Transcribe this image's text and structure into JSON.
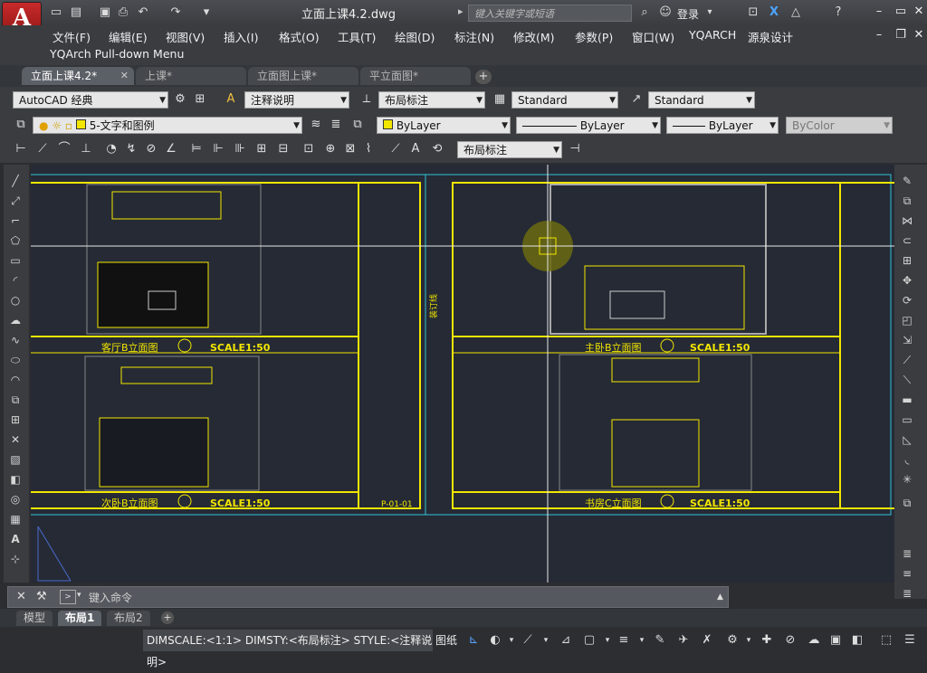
{
  "app": {
    "logo_letter": "A",
    "title": "立面上课4.2.dwg",
    "search_placeholder": "键入关键字或短语",
    "login": "登录"
  },
  "menu": [
    "文件(F)",
    "编辑(E)",
    "视图(V)",
    "插入(I)",
    "格式(O)",
    "工具(T)",
    "绘图(D)",
    "标注(N)",
    "修改(M)",
    "参数(P)",
    "窗口(W)",
    "YQARCH",
    "源泉设计"
  ],
  "pulldown_menu": "YQArch Pull-down Menu",
  "tabs": [
    {
      "label": "立面上课4.2*",
      "active": true
    },
    {
      "label": "上课*",
      "active": false
    },
    {
      "label": "立面图上课*",
      "active": false
    },
    {
      "label": "平立面图*",
      "active": false
    }
  ],
  "toolbar1": {
    "workspace": "AutoCAD 经典",
    "text_style": "注释说明",
    "dim_style": "布局标注",
    "table_style": "Standard",
    "multileader_style": "Standard"
  },
  "toolbar2": {
    "layer": "5-文字和图例",
    "color": "ByLayer",
    "linetype": "ByLayer",
    "lineweight": "ByLayer",
    "plotstyle": "ByColor"
  },
  "toolbar3": {
    "dim_style": "布局标注"
  },
  "drawing": {
    "view_titles": [
      "客厅B立面图",
      "主卧B立面图",
      "次卧B立面图",
      "书房C立面图"
    ],
    "scale_label": "SCALE1:50",
    "sheet_no": "P-01-01",
    "center_label": "装订线"
  },
  "command": {
    "placeholder": "键入命令"
  },
  "layout_tabs": [
    {
      "label": "模型",
      "active": false
    },
    {
      "label": "布局1",
      "active": true
    },
    {
      "label": "布局2",
      "active": false
    }
  ],
  "status": {
    "vars": "DIMSCALE:<1:1> DIMSTY:<布局标注> STYLE:<注释说明>",
    "paper": "图纸"
  },
  "colors": {
    "drawing_bg": "#252a35",
    "frame_yellow": "#f2e600",
    "cyan": "#2fc4d6"
  }
}
